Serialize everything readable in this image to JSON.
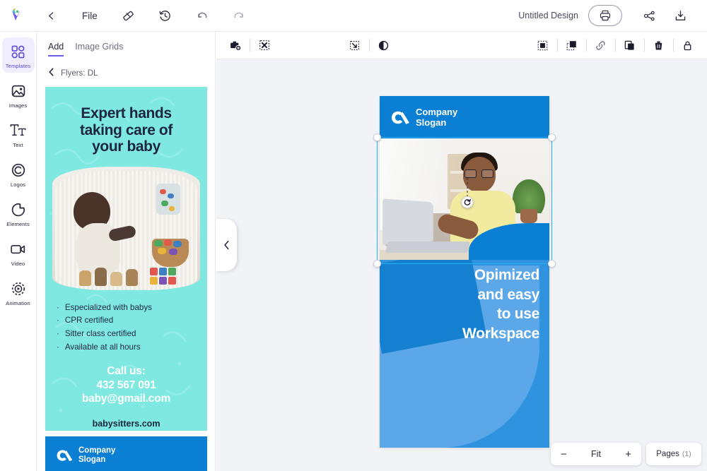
{
  "app": {
    "logo_icon": "app-logo-v",
    "back_icon": "chevron-left-icon",
    "file_menu": "File",
    "tools": [
      {
        "name": "ruler-icon"
      },
      {
        "name": "history-icon"
      },
      {
        "name": "undo-icon"
      },
      {
        "name": "redo-icon"
      }
    ],
    "document_title": "Untitled Design",
    "print_icon": "print-icon",
    "share_icon": "share-icon",
    "download_icon": "download-icon"
  },
  "sidebar": {
    "items": [
      {
        "label": "Templates",
        "icon": "templates-icon",
        "active": true
      },
      {
        "label": "Images",
        "icon": "images-icon",
        "active": false
      },
      {
        "label": "Text",
        "icon": "text-icon",
        "active": false
      },
      {
        "label": "Logos",
        "icon": "logos-icon",
        "active": false
      },
      {
        "label": "Elements",
        "icon": "elements-icon",
        "active": false
      },
      {
        "label": "Video",
        "icon": "video-icon",
        "active": false
      },
      {
        "label": "Animation",
        "icon": "animation-icon",
        "active": false
      }
    ]
  },
  "panel": {
    "tabs": [
      {
        "label": "Add",
        "active": true
      },
      {
        "label": "Image Grids",
        "active": false
      }
    ],
    "breadcrumb": "Flyers: DL",
    "breadcrumb_icon": "chevron-left-icon",
    "collapse_icon": "chevron-left-icon",
    "template": {
      "heading_line1": "Expert hands",
      "heading_line2": "taking care of",
      "heading_line3": "your baby",
      "bullets": [
        "Especialized with babys",
        "CPR certified",
        "Sitter class certified",
        "Available at all hours"
      ],
      "call_label": "Call us:",
      "phone": "432 567 091",
      "email": "baby@gmail.com",
      "website": "babysitters.com",
      "bg_color": "#7FE9E1",
      "heading_color": "#1C2541"
    },
    "template2": {
      "company": "Company",
      "slogan": "Slogan",
      "bg_color": "#0B7FD4"
    }
  },
  "canvas_toolbar": {
    "left": [
      {
        "name": "add-image-icon"
      },
      {
        "name": "remove-image-icon"
      }
    ],
    "center": [
      {
        "name": "crop-icon"
      },
      {
        "name": "contrast-icon"
      }
    ],
    "right": [
      {
        "name": "bring-to-front-icon"
      },
      {
        "name": "send-to-back-icon"
      },
      {
        "name": "link-icon"
      },
      {
        "name": "duplicate-icon"
      },
      {
        "name": "delete-icon"
      },
      {
        "name": "lock-icon"
      }
    ]
  },
  "design": {
    "header": {
      "company": "Company",
      "slogan": "Slogan",
      "bg_color": "#0B7FD4"
    },
    "headline_lines": [
      "Opimized",
      "and easy",
      "to use",
      "Workspace"
    ],
    "body_bg": "#2F93DF",
    "shape_light": "#5BA7E8",
    "shape_dark": "#1580CF",
    "selection_color": "#27B0EF"
  },
  "bottom": {
    "zoom_out": "−",
    "zoom_level": "Fit",
    "zoom_in": "+",
    "pages_label": "Pages",
    "pages_count": "(1)"
  }
}
